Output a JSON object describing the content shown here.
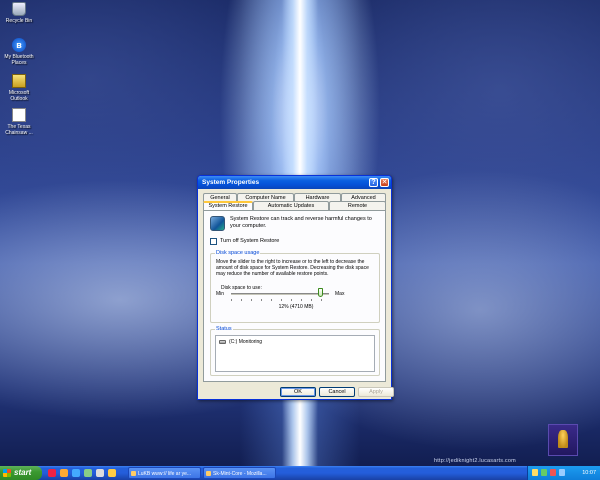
{
  "desktop": {
    "icons": [
      {
        "label": "Recycle Bin",
        "icon": "recycle-bin-icon"
      },
      {
        "label": "My Bluetooth Places",
        "icon": "bluetooth-icon"
      },
      {
        "label": "Microsoft Outlook",
        "icon": "outlook-icon"
      },
      {
        "label": "The Texas Chainsaw ...",
        "icon": "document-icon"
      }
    ],
    "watermark_url": "http://jediknight2.lucasarts.com"
  },
  "dialog": {
    "title": "System Properties",
    "help_glyph": "?",
    "close_glyph": "✕",
    "tabs_row1": [
      "General",
      "Computer Name",
      "Hardware",
      "Advanced"
    ],
    "tabs_row2": [
      "System Restore",
      "Automatic Updates",
      "Remote"
    ],
    "active_tab": "System Restore",
    "intro": "System Restore can track and reverse harmful changes to your computer.",
    "turn_off_label": "Turn off System Restore",
    "turn_off_checked": false,
    "disk_group": {
      "title": "Disk space usage",
      "description": "Move the slider to the right to increase or to the left to decrease the amount of disk space for System Restore. Decreasing the disk space may reduce the number of available restore points.",
      "use_label": "Disk space to use:",
      "min_label": "Min",
      "max_label": "Max",
      "value_text": "12% (4710 MB)",
      "slider_fraction": 0.92
    },
    "status_group": {
      "title": "Status",
      "drive": "(C:) Monitoring"
    },
    "buttons": {
      "ok": "OK",
      "cancel": "Cancel",
      "apply": "Apply"
    }
  },
  "taskbar": {
    "start_label": "start",
    "tasks": [
      {
        "label": "LuKB www:// life ar ye..."
      },
      {
        "label": "Sk-Mint-Core - Mozilla..."
      }
    ],
    "clock": "10:07"
  },
  "colors": {
    "title_bar": "#0550d6",
    "start_green": "#3c9a32",
    "group_label_blue": "#0046d5",
    "tab_highlight": "#ffc83c"
  }
}
